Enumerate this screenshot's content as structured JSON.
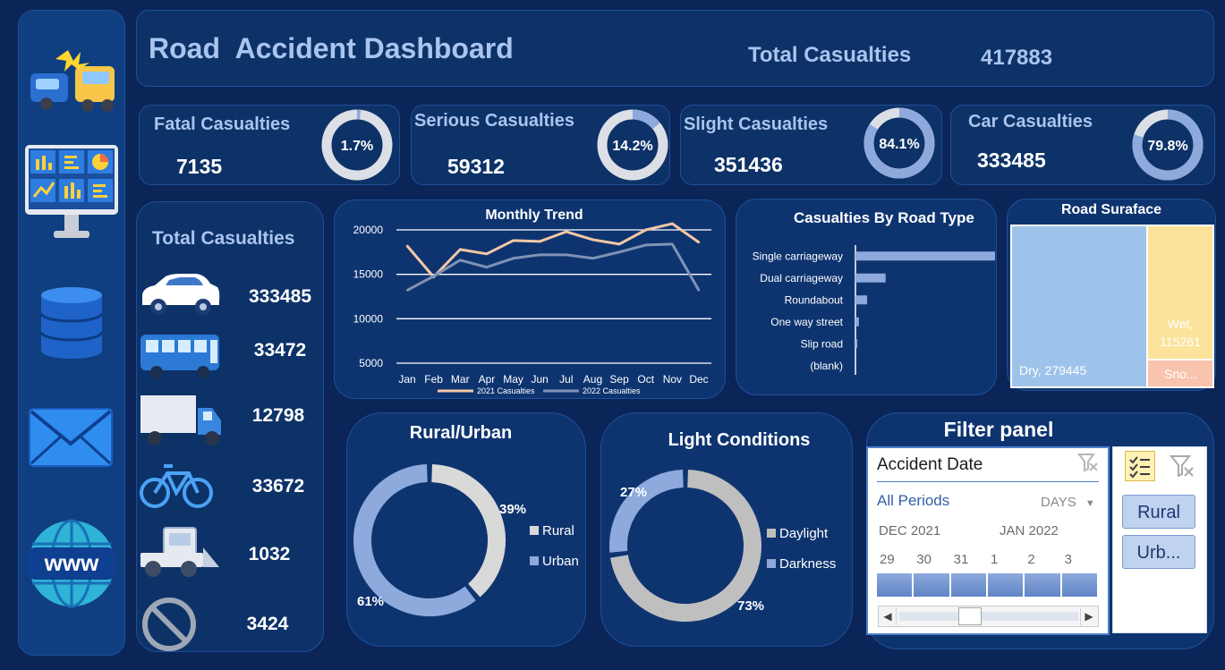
{
  "header": {
    "title": "Road  Accident Dashboard",
    "total_label": "Total Casualties",
    "total_value": "417883"
  },
  "kpis": [
    {
      "label": "Fatal Casualties",
      "value": "7135",
      "percent": "1.7%",
      "fraction": 0.017
    },
    {
      "label": "Serious Casualties",
      "value": "59312",
      "percent": "14.2%",
      "fraction": 0.142
    },
    {
      "label": "Slight Casualties",
      "value": "351436",
      "percent": "84.1%",
      "fraction": 0.841
    },
    {
      "label": "Car Casualties",
      "value": "333485",
      "percent": "79.8%",
      "fraction": 0.798
    }
  ],
  "vehicles": {
    "title": "Total Casualties",
    "items": [
      {
        "icon": "car-icon",
        "value": "333485"
      },
      {
        "icon": "bus-icon",
        "value": "33472"
      },
      {
        "icon": "truck-icon",
        "value": "12798"
      },
      {
        "icon": "bicycle-icon",
        "value": "33672"
      },
      {
        "icon": "agricultural-vehicle-icon",
        "value": "1032"
      },
      {
        "icon": "prohibited-icon",
        "value": "3424"
      }
    ]
  },
  "sidebar": {
    "icons": [
      "car-crash-icon",
      "dashboard-charts-icon",
      "database-icon",
      "mail-icon",
      "www-globe-icon"
    ]
  },
  "chart_data": [
    {
      "type": "line",
      "title": "Monthly Trend",
      "categories": [
        "Jan",
        "Feb",
        "Mar",
        "Apr",
        "May",
        "Jun",
        "Jul",
        "Aug",
        "Sep",
        "Oct",
        "Nov",
        "Dec"
      ],
      "series": [
        {
          "name": "2021 Casualties",
          "color": "#f4c7a5",
          "values": [
            18200,
            14700,
            17800,
            17300,
            18800,
            18700,
            19800,
            18900,
            18400,
            20000,
            20700,
            18600
          ]
        },
        {
          "name": "2022 Casualties",
          "color": "#7f93b6",
          "values": [
            13200,
            14800,
            16600,
            15800,
            16800,
            17200,
            17200,
            16800,
            17500,
            18300,
            18400,
            13200
          ]
        }
      ],
      "yticks": [
        "20000",
        "15000",
        "10000",
        "5000"
      ],
      "ylim": [
        5000,
        20000
      ],
      "grid": true,
      "legend": "bottom"
    },
    {
      "type": "bar",
      "title": "Casualties By Road Type",
      "categories": [
        "Single carriageway",
        "Dual carriageway",
        "Roundabout",
        "One way street",
        "Slip road",
        "(blank)"
      ],
      "values": [
        310000,
        67000,
        26000,
        7700,
        4200,
        0
      ]
    },
    {
      "type": "treemap",
      "title": "Road Suraface",
      "items": [
        {
          "label": "Dry, 279445",
          "value": 279445,
          "color": "#9ec3ea"
        },
        {
          "label": "Wet,",
          "label2": "115261",
          "value": 115261,
          "color": "#fbe39b"
        },
        {
          "label": "Sno...",
          "color": "#f8c4ae"
        }
      ]
    },
    {
      "type": "pie",
      "title": "Rural/Urban",
      "items": [
        {
          "name": "Rural",
          "percent": "39%",
          "value": 39,
          "color": "#d9d9d9"
        },
        {
          "name": "Urban",
          "percent": "61%",
          "value": 61,
          "color": "#8ea9db"
        }
      ]
    },
    {
      "type": "pie",
      "title": "Light Conditions",
      "items": [
        {
          "name": "Daylight",
          "percent": "73%",
          "value": 73,
          "color": "#bfbfbf"
        },
        {
          "name": "Darkness",
          "percent": "27%",
          "value": 27,
          "color": "#8ea9db"
        }
      ]
    }
  ],
  "filter": {
    "title": "Filter panel",
    "timeline": {
      "title": "Accident Date",
      "period": "All Periods",
      "unit": "DAYS",
      "month1": "DEC 2021",
      "month2": "JAN 2022",
      "days": [
        "29",
        "30",
        "31",
        "1",
        "2",
        "3"
      ]
    },
    "slicer": {
      "options": [
        "Rural",
        "Urb..."
      ]
    }
  },
  "colors": {
    "background": "#0b2559",
    "panel": "#0e3470",
    "accent": "#a9c4ee"
  }
}
